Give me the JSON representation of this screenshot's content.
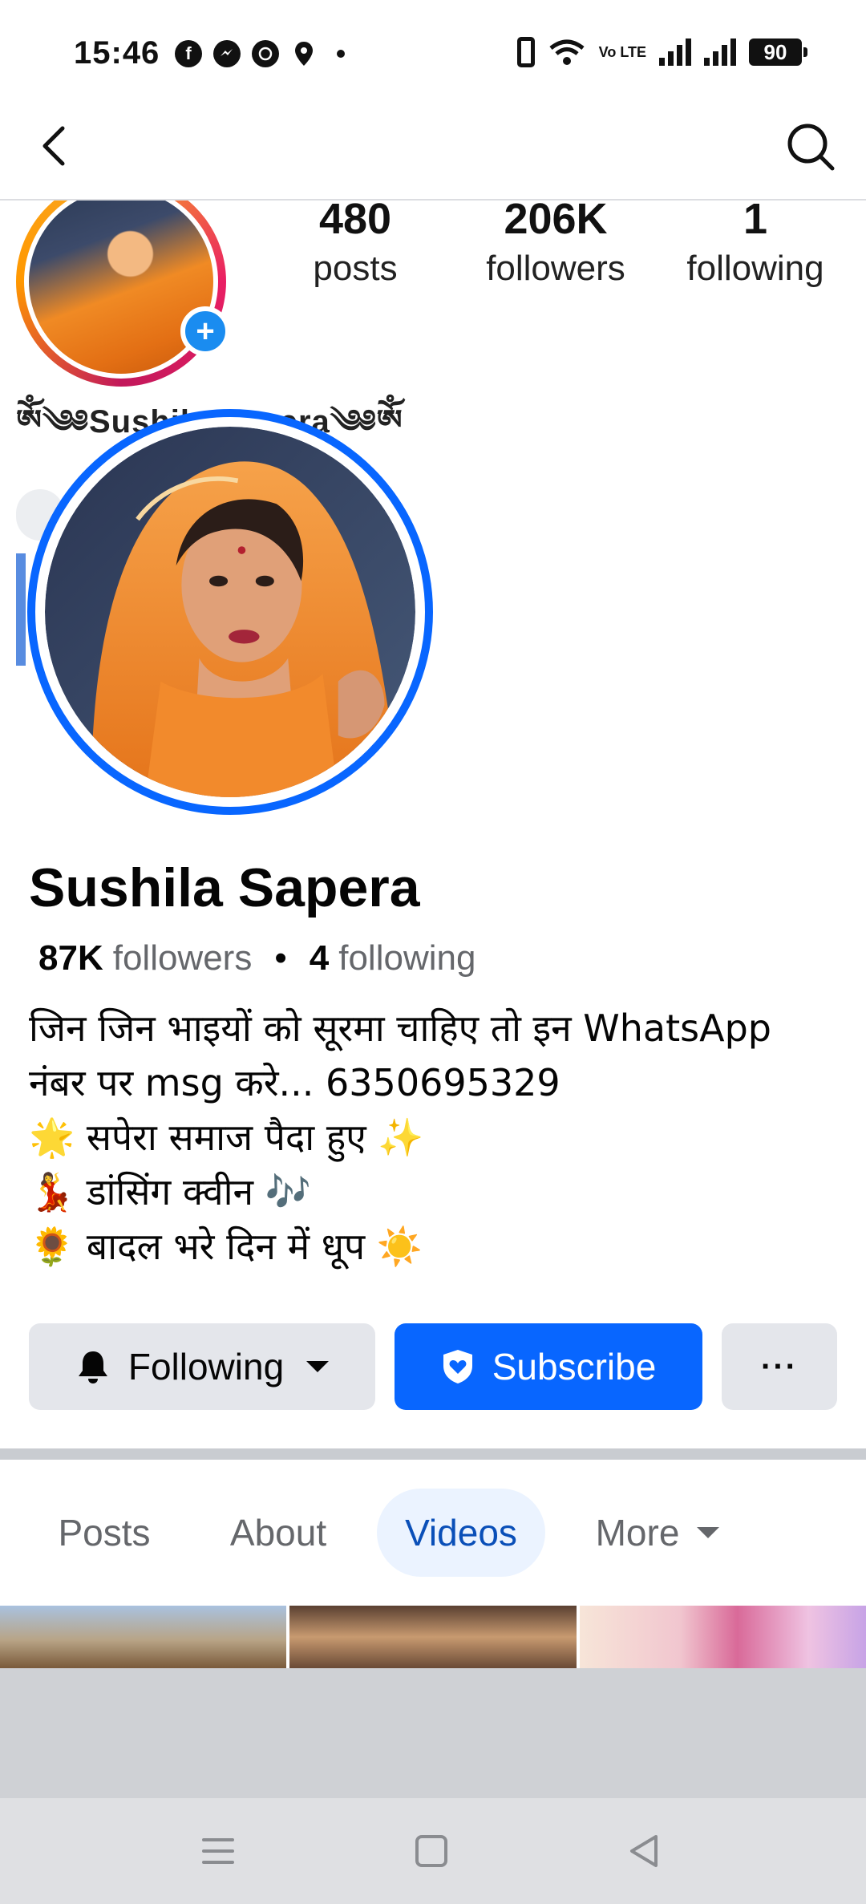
{
  "status_bar": {
    "time": "15:46",
    "app_icons": [
      "facebook-icon",
      "messenger-icon",
      "whatsapp-icon",
      "location-icon"
    ],
    "volte": "Vo LTE",
    "battery": "90"
  },
  "header": {
    "back_icon": "chevron-left-icon",
    "search_icon": "search-icon"
  },
  "embedded_instagram": {
    "stats": [
      {
        "value": "480",
        "label": "posts"
      },
      {
        "value": "206K",
        "label": "followers"
      },
      {
        "value": "1",
        "label": "following"
      }
    ],
    "name_banner": "ༀ༄༅Sushila Sapera༄༅ༀ"
  },
  "profile": {
    "name": "Sushila Sapera",
    "followers_count": "87K",
    "followers_label": "followers",
    "separator": "•",
    "following_count": "4",
    "following_label": "following",
    "bio_lines": [
      "जिन जिन भाइयों को सूरमा चाहिए तो इन WhatsApp",
      "नंबर पर msg करे... 6350695329",
      "🌟 सपेरा समाज पैदा हुए ✨",
      "💃 डांसिंग क्वीन 🎶",
      "🌻 बादल भरे दिन में धूप ☀️"
    ]
  },
  "actions": {
    "following_label": "Following",
    "subscribe_label": "Subscribe",
    "more_label": "···"
  },
  "tabs": [
    {
      "label": "Posts",
      "active": false
    },
    {
      "label": "About",
      "active": false
    },
    {
      "label": "Videos",
      "active": true
    },
    {
      "label": "More",
      "active": false
    }
  ],
  "colors": {
    "accent": "#0866ff",
    "active_tab_bg": "#ebf3ff",
    "active_tab_text": "#0a4fb8",
    "button_gray": "#e4e6eb"
  }
}
